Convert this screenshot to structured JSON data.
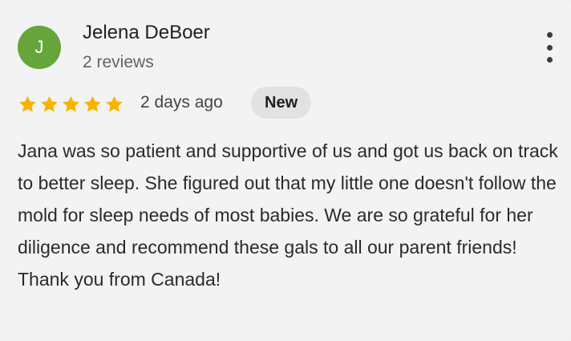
{
  "review": {
    "avatar_letter": "J",
    "avatar_color": "#66a53a",
    "reviewer_name": "Jelena DeBoer",
    "review_count": "2 reviews",
    "rating": 5,
    "rating_max": 5,
    "star_color": "#f6b400",
    "date": "2 days ago",
    "badge": "New",
    "text": "Jana was so patient and supportive of us and got us back on track to better sleep. She figured out that my little one doesn't follow the mold for sleep needs of most babies. We are so grateful for her diligence and recommend these gals to all our parent friends! Thank you from Canada!",
    "more_icon": "more-vert-icon"
  }
}
